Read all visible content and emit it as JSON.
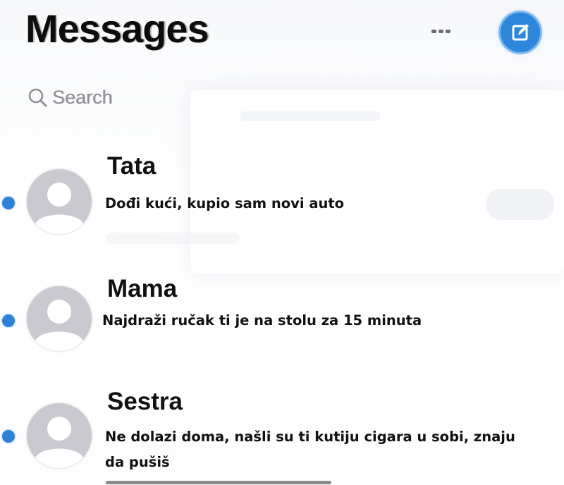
{
  "header": {
    "title": "Messages",
    "more_icon": "ellipsis-icon",
    "compose_icon": "compose-icon"
  },
  "search": {
    "placeholder": "Search",
    "icon": "search-icon"
  },
  "colors": {
    "accent": "#2c86dc",
    "unread": "#2d82d8",
    "avatar": "#c9c9cf"
  },
  "conversations": [
    {
      "name": "Tata",
      "preview_lines": [
        "Dođi kući, kupio sam novi auto"
      ],
      "unread": true
    },
    {
      "name": "Mama",
      "preview_lines": [
        "Najdraži ručak ti je na stolu za 15 minuta"
      ],
      "unread": true
    },
    {
      "name": "Sestra",
      "preview_lines": [
        "Ne dolazi doma, našli su ti kutiju cigara u sobi, znaju",
        "da pušiš"
      ],
      "unread": true
    }
  ]
}
